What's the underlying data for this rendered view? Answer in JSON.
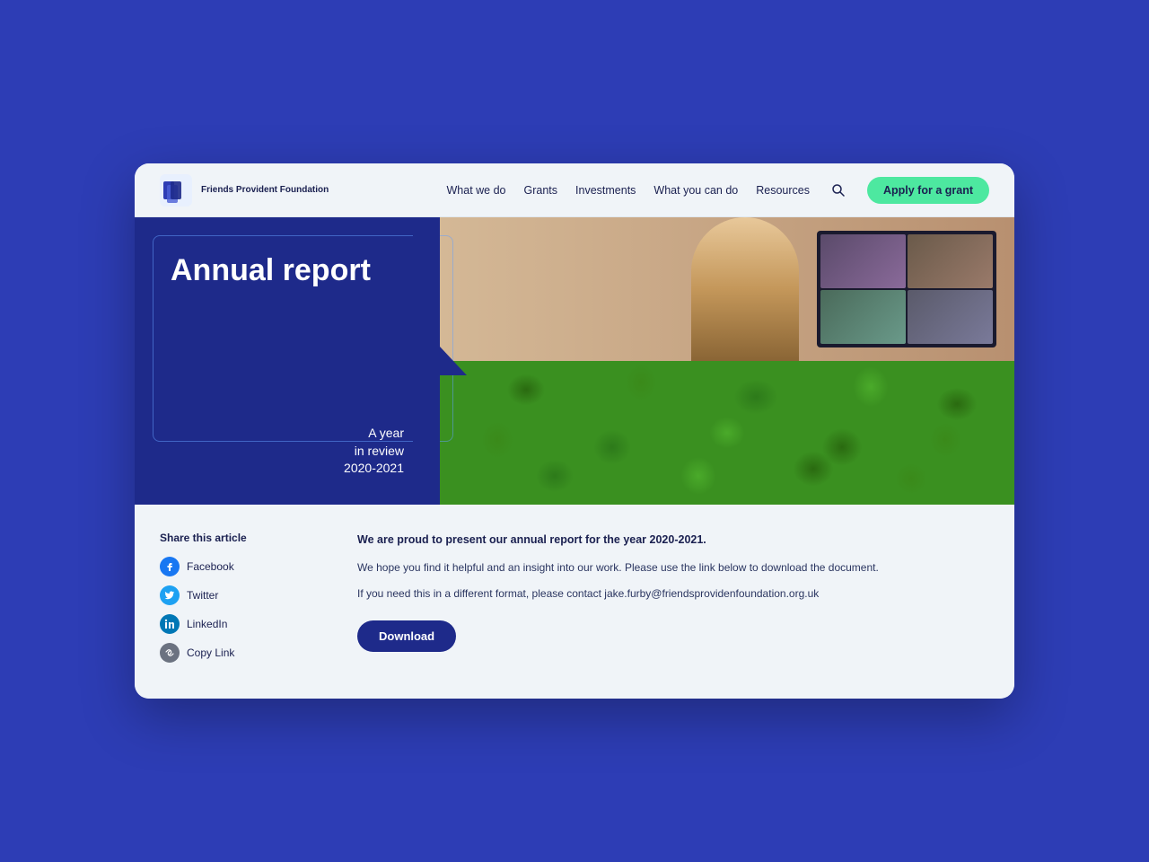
{
  "page": {
    "background_color": "#2d3db5"
  },
  "navbar": {
    "logo_text": "Friends\nProvident\nFoundation",
    "links": [
      {
        "id": "what-we-do",
        "label": "What we do"
      },
      {
        "id": "grants",
        "label": "Grants"
      },
      {
        "id": "investments",
        "label": "Investments"
      },
      {
        "id": "what-you-can-do",
        "label": "What you can do"
      },
      {
        "id": "resources",
        "label": "Resources"
      }
    ],
    "apply_button_label": "Apply for a grant"
  },
  "hero": {
    "title": "Annual\nreport",
    "subtitle_line1": "A year",
    "subtitle_line2": "in review",
    "subtitle_line3": "2020-2021"
  },
  "share": {
    "title": "Share this article",
    "items": [
      {
        "id": "facebook",
        "label": "Facebook",
        "icon": "facebook-icon"
      },
      {
        "id": "twitter",
        "label": "Twitter",
        "icon": "twitter-icon"
      },
      {
        "id": "linkedin",
        "label": "LinkedIn",
        "icon": "linkedin-icon"
      },
      {
        "id": "copy-link",
        "label": "Copy Link",
        "icon": "copy-icon"
      }
    ]
  },
  "article": {
    "intro": "We are proud to present our annual report for the year 2020-2021.",
    "body1": "We hope you find it helpful and an insight into our work. Please use the link below to download the document.",
    "body2": "If you need this in a different format, please contact jake.furby@friendsprovidenfoundation.org.uk",
    "download_label": "Download"
  }
}
